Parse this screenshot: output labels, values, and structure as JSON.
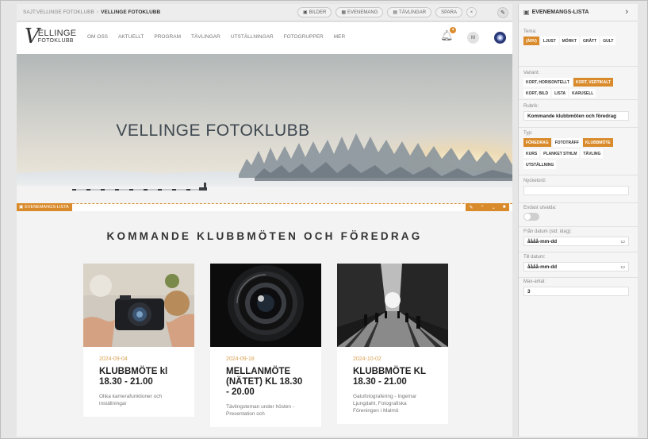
{
  "breadcrumb": {
    "parent": "SAJT:VELLINGE FOTOKLUBB",
    "separator": "›",
    "current": "VELLINGE FOTOKLUBB"
  },
  "top_actions": {
    "bilder": "BILDER",
    "evenemang": "EVENEMANG",
    "tavlingar": "TÄVLINGAR",
    "spara": "SPARA",
    "close": "×"
  },
  "site": {
    "logo_initial": "V",
    "logo_line1": "ELLINGE",
    "logo_line2": "FOTOKLUBB",
    "nav": [
      "OM OSS",
      "AKTUELLT",
      "PROGRAM",
      "TÄVLINGAR",
      "UTSTÄLLNINGAR",
      "FOTOGRUPPER",
      "MER"
    ],
    "notification_count": "4",
    "avatar_initial": "M",
    "hero_title": "VELLINGE FOTOKLUBB",
    "section_label": "EVENEMANGS-LISTA"
  },
  "events": {
    "title": "KOMMANDE KLUBBMÖTEN OCH FÖREDRAG",
    "cards": [
      {
        "date": "2024-09-04",
        "title": "KLUBBMÖTE kl 18.30 - 21.00",
        "desc": "Olika kamerafunktioner och inställningar"
      },
      {
        "date": "2024-09-18",
        "title": "MELLANMÖTE (NÄTET) KL 18.30 - 20.00",
        "desc": "Tävlingsteman under hösten - Presentation och"
      },
      {
        "date": "2024-10-02",
        "title": "KLUBBMÖTE KL 18.30 - 21.00",
        "desc": "Gatufotografering - Ingemar Ljungdahl, Fotografiska Föreningen i Malmö"
      }
    ]
  },
  "panel": {
    "title": "EVENEMANGS-LISTA",
    "close": "›",
    "tema_label": "Tema:",
    "tema_options": [
      "(ÄRV)",
      "LJUST",
      "MÖRKT",
      "GRÅTT",
      "GULT"
    ],
    "tema_selected": "(ÄRV)",
    "variant_label": "Variant:",
    "variant_options": [
      "KORT, HORISONTELLT",
      "KORT, VERTIKALT",
      "KORT, BILD",
      "LISTA",
      "KARUSELL"
    ],
    "variant_selected": "KORT, VERTIKALT",
    "rubrik_label": "Rubrik:",
    "rubrik_value": "Kommande klubbmöten och föredrag",
    "typ_label": "Typ:",
    "typ_options": [
      "FÖREDRAG",
      "FOTOTRÄFF",
      "KLUBBMÖTE",
      "KURS",
      "PLANKET STHLM",
      "TÄVLING",
      "UTSTÄLLNING"
    ],
    "typ_selected": [
      "FÖREDRAG",
      "KLUBBMÖTE"
    ],
    "nyckelord_label": "Nyckelord:",
    "nyckelord_value": "",
    "endast_label": "Endast utvalda:",
    "endast_value": false,
    "fran_label": "Från datum (std: idag):",
    "fran_value": "åååå-mm-dd",
    "till_label": "Till datum:",
    "till_value": "åååå-mm-dd",
    "max_label": "Max-antal:",
    "max_value": "3"
  },
  "colors": {
    "accent": "#d98b2b",
    "date": "#d9a155",
    "panel_bg": "#f5f5f5"
  }
}
